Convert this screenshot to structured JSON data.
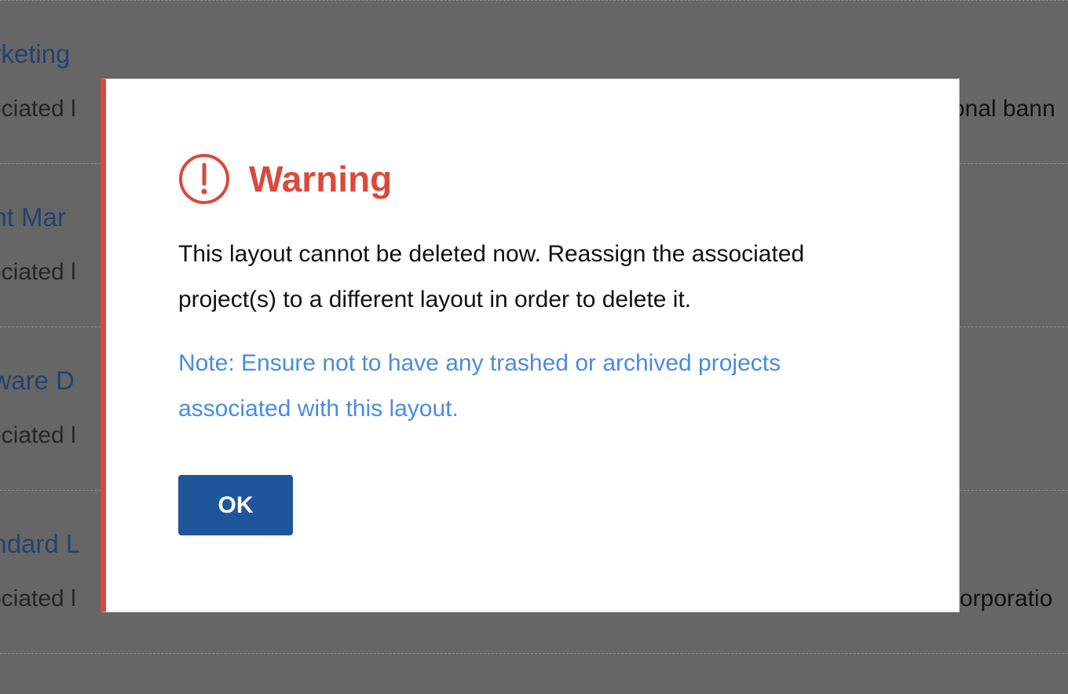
{
  "background": {
    "rows": [
      {
        "title": "arketing",
        "subtitle": "sociated l",
        "right_text": "onal bann"
      },
      {
        "title": "ent Mar",
        "subtitle": "sociated l",
        "right_text": ""
      },
      {
        "title": "ftware D",
        "subtitle": "sociated l",
        "right_text": ""
      },
      {
        "title": "andard L",
        "subtitle": "sociated l",
        "right_text": "orporatio"
      }
    ]
  },
  "dialog": {
    "title": "Warning",
    "icon": "warning-circle-icon",
    "message": "This layout cannot be deleted now. Reassign the associated project(s) to a different layout in order to delete it.",
    "note": "Note: Ensure not to have any trashed or archived projects associated with this layout.",
    "ok_label": "OK"
  },
  "colors": {
    "accent_red": "#d84a3c",
    "note_blue": "#4a8be0",
    "button_blue": "#1f5699",
    "overlay": "#666666"
  }
}
